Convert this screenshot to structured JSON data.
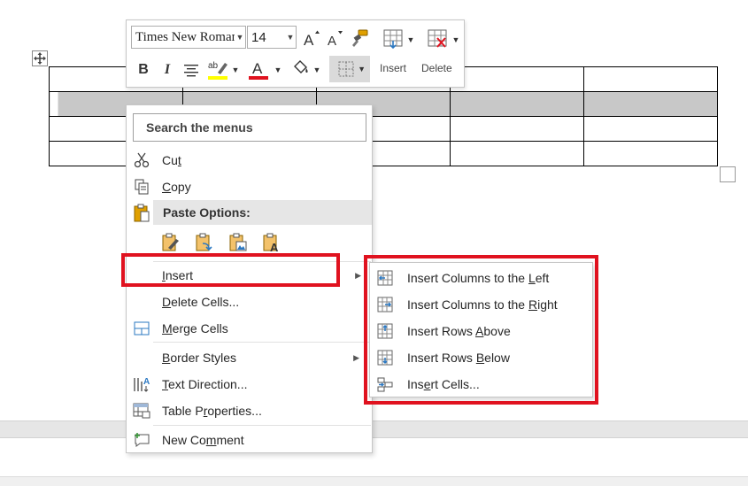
{
  "toolbar": {
    "font_name": "Times New Roman",
    "font_size": "14",
    "insert_label": "Insert",
    "delete_label": "Delete",
    "colors": {
      "highlight": "#ffff00",
      "font_color": "#e0121f"
    }
  },
  "table": {
    "rows": 4,
    "columns": 5,
    "selected_row_index": 1
  },
  "context_menu": {
    "search_placeholder": "Search the menus",
    "cut": {
      "label": "Cut",
      "pre": "Cu",
      "key": "t",
      "post": ""
    },
    "copy": {
      "label": "Copy",
      "pre": "",
      "key": "C",
      "post": "opy"
    },
    "paste_options": "Paste Options:",
    "paste_icons": [
      "paste-keep-source-formatting-icon",
      "paste-merge-formatting-icon",
      "paste-picture-icon",
      "paste-keep-text-only-icon"
    ],
    "insert": {
      "label": "Insert",
      "pre": "",
      "key": "I",
      "post": "nsert"
    },
    "delete_cells": {
      "label": "Delete Cells...",
      "pre": "",
      "key": "D",
      "post": "elete Cells..."
    },
    "merge_cells": {
      "label": "Merge Cells",
      "pre": "",
      "key": "M",
      "post": "erge Cells"
    },
    "border_styles": {
      "label": "Border Styles",
      "pre": "",
      "key": "B",
      "post": "order Styles"
    },
    "text_direction": {
      "label": "Text Direction...",
      "pre": "",
      "key": "T",
      "post": "ext Direction..."
    },
    "table_properties": {
      "label": "Table Properties...",
      "pre": "Table P",
      "key": "r",
      "post": "operties..."
    },
    "new_comment": {
      "label": "New Comment",
      "pre": "New Co",
      "key": "m",
      "post": "ment"
    }
  },
  "insert_submenu": {
    "columns_left": {
      "label": "Insert Columns to the Left",
      "pre": "Insert Columns to the ",
      "key": "L",
      "post": "eft"
    },
    "columns_right": {
      "label": "Insert Columns to the Right",
      "pre": "Insert Columns to the ",
      "key": "R",
      "post": "ight"
    },
    "rows_above": {
      "label": "Insert Rows Above",
      "pre": "Insert Rows ",
      "key": "A",
      "post": "bove"
    },
    "rows_below": {
      "label": "Insert Rows Below",
      "pre": "Insert Rows ",
      "key": "B",
      "post": "elow"
    },
    "cells": {
      "label": "Insert Cells...",
      "pre": "Ins",
      "key": "e",
      "post": "rt Cells..."
    }
  },
  "highlight_color": "#e0121f"
}
